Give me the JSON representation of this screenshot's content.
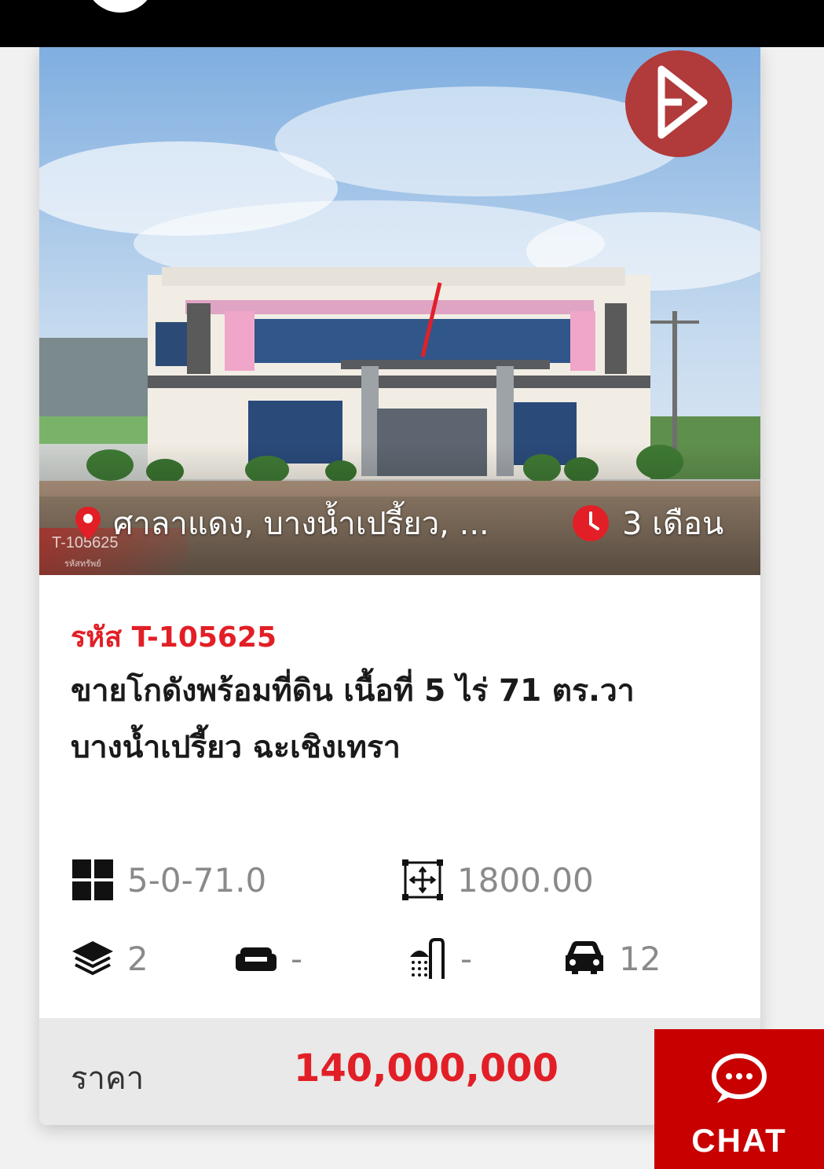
{
  "listing": {
    "location": "ศาลาแดง, บางน้ำเปรี้ยว, ...",
    "posted_ago": "3 เดือน",
    "watermark_code": "T-105625",
    "watermark_sub": "รหัสทรัพย์",
    "code_line": "รหัส T-105625",
    "title": "ขายโกดังพร้อมที่ดิน เนื้อที่ 5 ไร่ 71 ตร.วา บางน้ำเปรี้ยว ฉะเชิงเทรา",
    "land_area": "5-0-71.0",
    "usable_area": "1800.00",
    "floors": "2",
    "bedrooms": "-",
    "bathrooms": "-",
    "parking": "12",
    "price_label": "ราคา",
    "price": "140,000,000"
  },
  "chat": {
    "label": "CHAT"
  },
  "colors": {
    "accent": "#e21f26",
    "chat_bg": "#c80000",
    "top_bar": "#000000"
  },
  "icons": [
    "location-pin-icon",
    "clock-icon",
    "land-grid-icon",
    "area-expand-icon",
    "layers-icon",
    "sofa-icon",
    "shower-icon",
    "car-icon",
    "chat-bubble-icon",
    "brand-logo-icon"
  ]
}
